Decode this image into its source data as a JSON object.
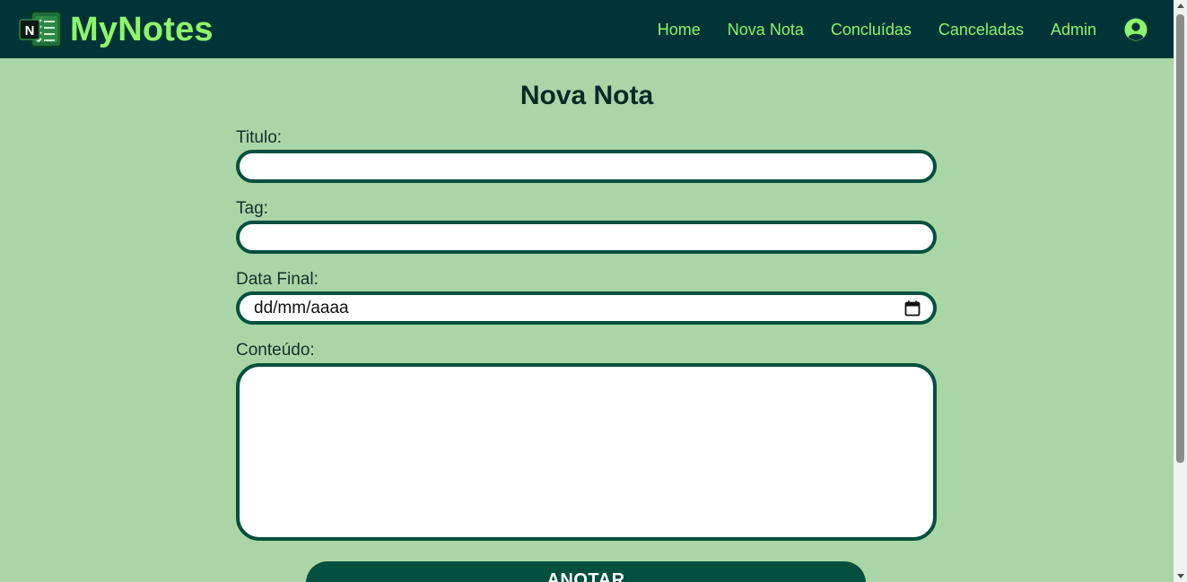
{
  "app": {
    "name": "MyNotes",
    "logo_letter": "N",
    "logo_icon": "notes-logo-icon"
  },
  "nav": {
    "items": [
      {
        "label": "Home"
      },
      {
        "label": "Nova Nota"
      },
      {
        "label": "Concluídas"
      },
      {
        "label": "Canceladas"
      },
      {
        "label": "Admin"
      }
    ],
    "user_icon": "user-circle-icon"
  },
  "page": {
    "title": "Nova Nota"
  },
  "form": {
    "titulo_label": "Titulo:",
    "titulo_value": "",
    "tag_label": "Tag:",
    "tag_value": "",
    "data_label": "Data Final:",
    "data_placeholder": "dd/mm/aaaa",
    "data_icon": "calendar-icon",
    "conteudo_label": "Conteúdo:",
    "conteudo_value": "",
    "submit_label": "ANOTAR"
  },
  "colors": {
    "navbar_bg": "#003438",
    "nav_text": "#8ef56a",
    "page_bg": "#aad5a7",
    "field_border": "#04503f",
    "button_bg": "#04503f"
  }
}
